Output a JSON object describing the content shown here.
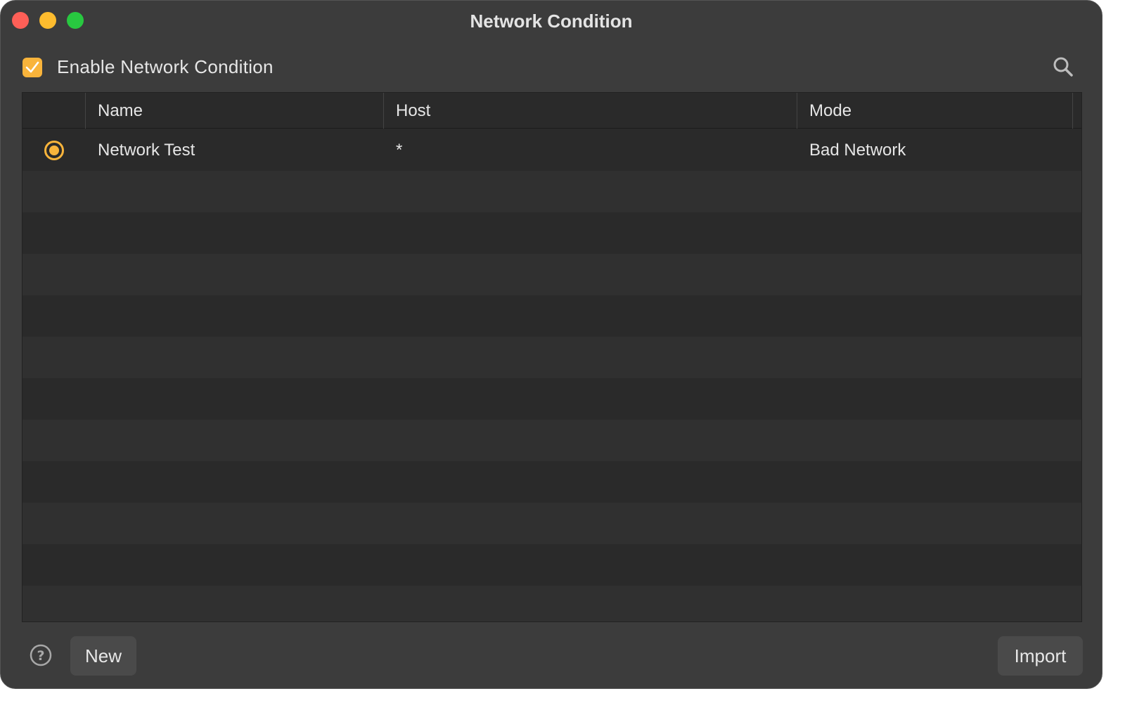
{
  "window": {
    "title": "Network Condition"
  },
  "toolbar": {
    "enable_label": "Enable Network Condition",
    "enable_checked": true,
    "search_icon": "search-icon"
  },
  "table": {
    "columns": [
      "",
      "Name",
      "Host",
      "Mode"
    ],
    "rows": [
      {
        "selected": true,
        "name": "Network Test",
        "host": "*",
        "mode": "Bad Network"
      }
    ]
  },
  "footer": {
    "help_icon": "help-icon",
    "new_label": "New",
    "import_label": "Import"
  },
  "colors": {
    "accent": "#f9b43b",
    "window_bg": "#3c3c3c",
    "table_bg": "#2a2a2a",
    "row_alt": "#303030",
    "close": "#fe5f57",
    "minimize": "#febc2e",
    "maximize": "#28c840"
  }
}
